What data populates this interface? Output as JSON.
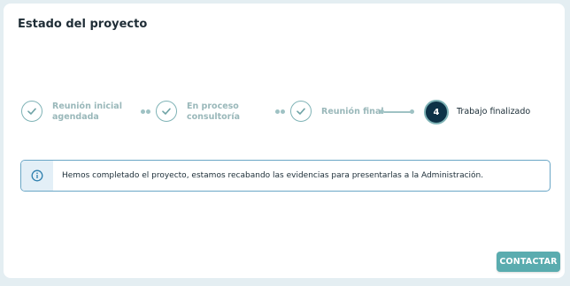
{
  "card": {
    "title": "Estado del proyecto"
  },
  "stepper": {
    "steps": [
      {
        "state": "completed",
        "label_line1": "Reunión inicial",
        "label_line2": "agendada",
        "icon": "check-icon"
      },
      {
        "state": "completed",
        "label_line1": "En proceso",
        "label_line2": "consultoría",
        "icon": "check-icon"
      },
      {
        "state": "completed",
        "label_line1": "Reunión final",
        "label_line2": "",
        "icon": "check-icon"
      },
      {
        "state": "current",
        "number": "4",
        "label_line1": "Trabajo finalizado",
        "label_line2": ""
      }
    ]
  },
  "info_alert": {
    "icon": "info-icon",
    "text": "Hemos completado el proyecto, estamos recabando las evidencias para presentarlas a la Administración."
  },
  "actions": {
    "contact_label": "CONTACTAR"
  },
  "colors": {
    "accent": "#5aacaf",
    "step_done": "#7fb3b6",
    "step_active": "#0d3247",
    "info_border": "#6aa6c6",
    "info_bg": "#e3eff7"
  }
}
